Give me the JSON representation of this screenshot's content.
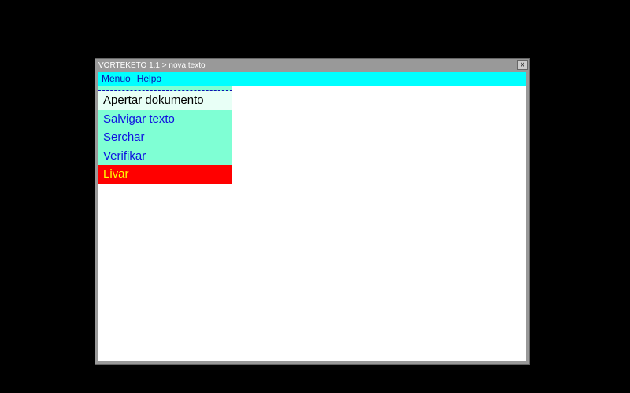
{
  "window": {
    "title": "VORTEKETO 1.1 > nova texto",
    "close_symbol": "x"
  },
  "menubar": {
    "items": [
      {
        "label": "Menuo"
      },
      {
        "label": "Helpo"
      }
    ]
  },
  "dropdown": {
    "items": [
      {
        "label": "Apertar dokumento",
        "state": "hovered"
      },
      {
        "label": "Salvigar texto",
        "state": "normal"
      },
      {
        "label": "Serchar",
        "state": "normal"
      },
      {
        "label": "Verifikar",
        "state": "normal"
      },
      {
        "label": "Livar",
        "state": "danger"
      }
    ]
  },
  "colors": {
    "cyan": "#00ffff",
    "aquamarine": "#7fffd4",
    "red": "#ff0000",
    "yellow": "#ffff00",
    "blue": "#1010e0"
  }
}
